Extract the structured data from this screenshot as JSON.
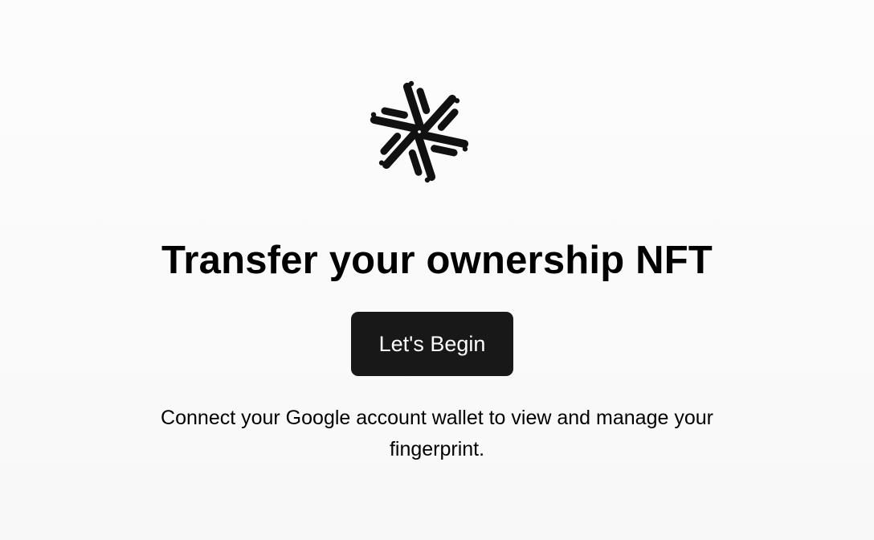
{
  "logo": {
    "icon": "woven-star-logo-icon",
    "color": "#111111"
  },
  "hero": {
    "title": "Transfer your ownership NFT",
    "button_label": "Let's Begin",
    "description": "Connect your Google account wallet to view and manage your fingerprint."
  },
  "colors": {
    "background": "#f9f9f9",
    "button_background": "#181818",
    "button_text": "#ffffff",
    "text": "#000000"
  }
}
